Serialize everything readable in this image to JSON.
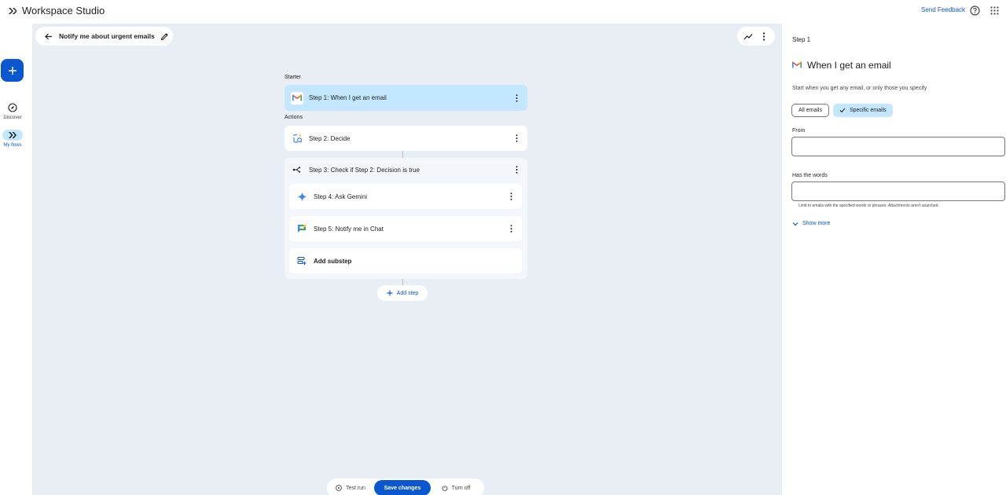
{
  "app": {
    "title": "Workspace Studio",
    "send_feedback": "Send Feedback",
    "icons": {
      "brand": "workspace-studio-logo-icon",
      "help": "help-icon",
      "apps": "apps-grid-icon"
    }
  },
  "rail": {
    "create_icon": "plus-icon",
    "items": [
      {
        "label": "Discover",
        "icon": "compass-icon",
        "active": false
      },
      {
        "label": "My flows",
        "icon": "flows-icon",
        "active": true
      }
    ]
  },
  "flow": {
    "title": "Notify me about urgent emails",
    "starter_label": "Starter",
    "actions_label": "Actions",
    "steps": [
      {
        "prefix": "Step 1:",
        "text": "When I get an email",
        "icon": "gmail-icon",
        "selected": true
      },
      {
        "prefix": "Step 2:",
        "text": "Decide",
        "icon": "decide-icon"
      },
      {
        "prefix": "Step 3:",
        "text": "Check if Step 2: Decision is true",
        "icon": "branch-icon"
      },
      {
        "prefix": "Step 4:",
        "text": "Ask Gemini",
        "icon": "gemini-icon"
      },
      {
        "prefix": "Step 5:",
        "text": "Notify me in Chat",
        "icon": "google-chat-icon"
      }
    ],
    "add_substep": "Add substep",
    "add_step": "Add step"
  },
  "bottom_bar": {
    "test_run": "Test run",
    "save_changes": "Save changes",
    "turn_off": "Turn off"
  },
  "panel": {
    "step_label": "Step 1",
    "trigger_title": "When I get an email",
    "description": "Start when you get any email, or only those you specify",
    "chips": {
      "all": "All emails",
      "specific": "Specific emails",
      "selected": "specific"
    },
    "from_label": "From",
    "from_value": "",
    "words_label": "Has the words",
    "words_value": "",
    "words_help": "Limit to emails with the specified words or phrases. Attachments aren't searched.",
    "show_more": "Show more"
  },
  "colors": {
    "accent": "#0b57d0",
    "selected_bg": "#c2e7ff",
    "canvas_bg": "#e9edf4"
  }
}
